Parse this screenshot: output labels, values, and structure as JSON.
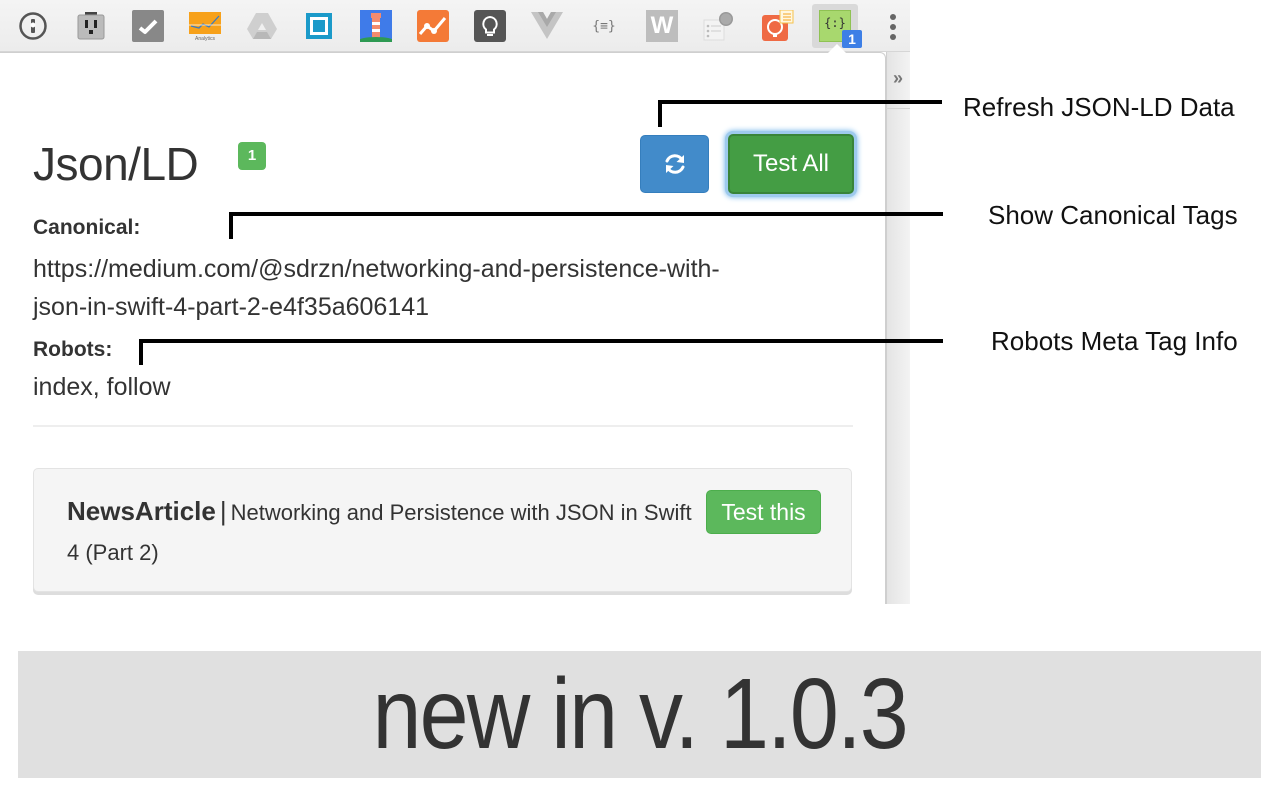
{
  "toolbar": {
    "extensions": [
      {
        "name": "1password-icon"
      },
      {
        "name": "outlet-icon"
      },
      {
        "name": "checkmark-extension-icon"
      },
      {
        "name": "analytics-icon",
        "label": "Analytics"
      },
      {
        "name": "drive-icon"
      },
      {
        "name": "square-frame-icon"
      },
      {
        "name": "lighthouse-icon"
      },
      {
        "name": "trend-chart-icon"
      },
      {
        "name": "lightbulb-icon"
      },
      {
        "name": "vue-icon"
      },
      {
        "name": "json-formatter-icon",
        "label": "{≡}"
      },
      {
        "name": "w-extension-icon",
        "label": "W"
      },
      {
        "name": "tasks-clock-icon"
      },
      {
        "name": "idea-list-icon"
      },
      {
        "name": "jsonld-extension-icon",
        "label": "{:}",
        "badge": "1"
      }
    ],
    "overflow_label": "»"
  },
  "popup": {
    "title": "Json/LD",
    "title_badge": "1",
    "refresh_button": "refresh",
    "test_all_label": "Test All",
    "canonical_label": "Canonical:",
    "canonical_line1": "https://medium.com/@sdrzn/networking-and-persistence-with-",
    "canonical_line2": "json-in-swift-4-part-2-e4f35a606141",
    "robots_label": "Robots:",
    "robots_value": "index, follow",
    "items": [
      {
        "type": "NewsArticle",
        "separator": "|",
        "headline": "Networking and Persistence with JSON in Swift 4 (Part 2)",
        "test_label": "Test this"
      }
    ]
  },
  "callouts": {
    "refresh": "Refresh JSON-LD Data",
    "canonical": "Show Canonical Tags",
    "robots": "Robots Meta Tag Info"
  },
  "banner": {
    "text": "new in v. 1.0.3"
  },
  "colors": {
    "primary_blue": "#428bca",
    "success_green": "#5cb85c",
    "active_green": "#449d44",
    "badge_blue": "#3d7fe6",
    "banner_bg": "#e0e0e0"
  }
}
